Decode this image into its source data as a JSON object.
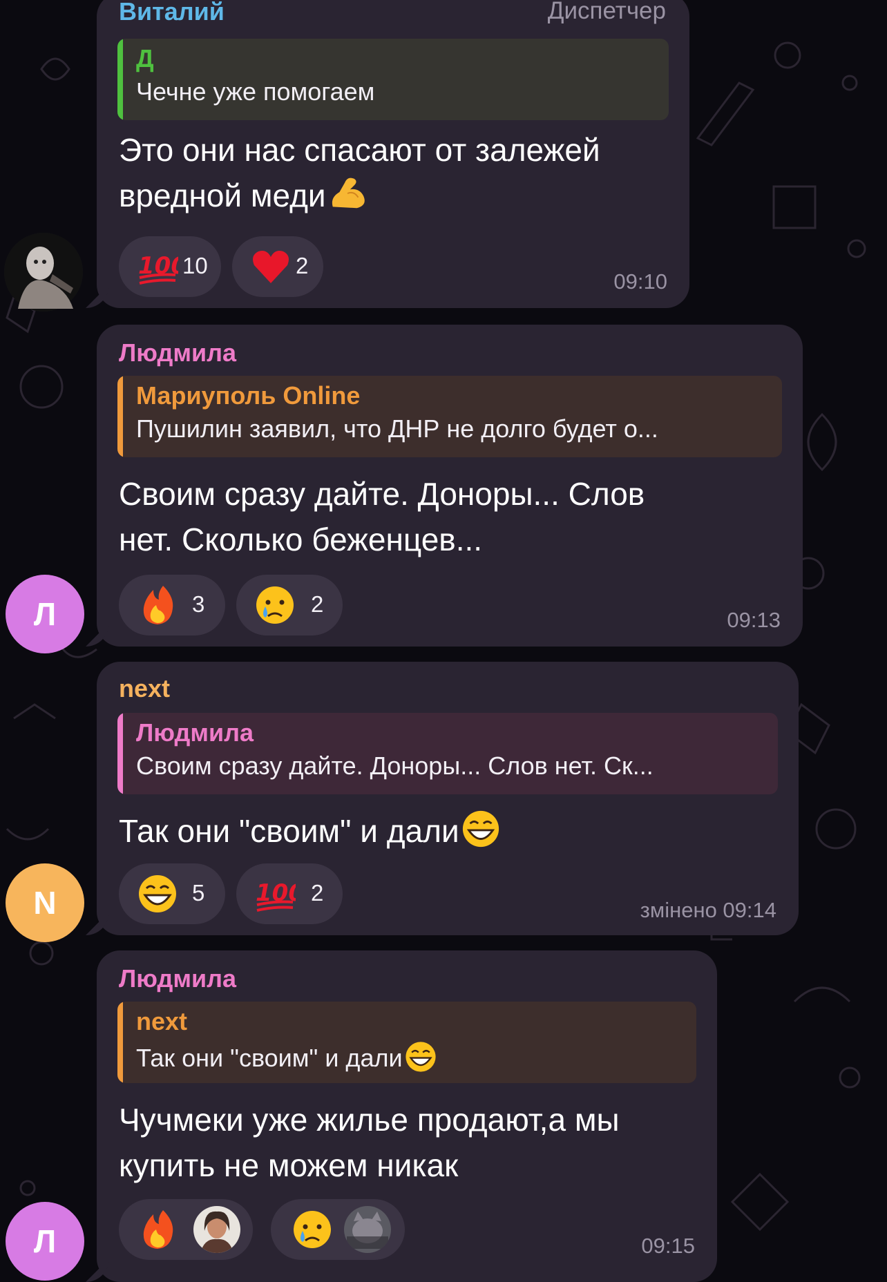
{
  "messages": [
    {
      "sender": "Виталий",
      "role": "Диспетчер",
      "reply_name": "Д",
      "reply_text": "Чечне уже помогаем",
      "text_lines": [
        "Это они нас спасают от залежей",
        "вредной меди"
      ],
      "trailing_emoji": "flexed-biceps-emoji",
      "reactions": [
        {
          "emoji": "hundred-points-emoji",
          "count": "10"
        },
        {
          "emoji": "red-heart-emoji",
          "count": "2"
        }
      ],
      "time": "09:10"
    },
    {
      "sender": "Людмила",
      "avatar_letter": "Л",
      "reply_name": "Мариуполь Online",
      "reply_text": "Пушилин заявил, что ДНР не долго будет о...",
      "text_lines": [
        "Своим сразу дайте. Доноры... Слов",
        "нет. Сколько беженцев..."
      ],
      "reactions": [
        {
          "emoji": "fire-emoji",
          "count": "3"
        },
        {
          "emoji": "crying-face-emoji",
          "count": "2"
        }
      ],
      "time": "09:13"
    },
    {
      "sender": "next",
      "avatar_letter": "N",
      "reply_name": "Людмила",
      "reply_text": "Своим сразу дайте. Доноры... Слов нет. Ск...",
      "text_lines": [
        "Так они \"своим\" и дали"
      ],
      "trailing_emoji": "grinning-face-emoji",
      "reactions": [
        {
          "emoji": "grinning-face-emoji",
          "count": "5"
        },
        {
          "emoji": "hundred-points-emoji",
          "count": "2"
        }
      ],
      "time": "змінено 09:14"
    },
    {
      "sender": "Людмила",
      "avatar_letter": "Л",
      "reply_name": "next",
      "reply_text": "Так они \"своим\" и дали",
      "text_lines": [
        "Чучмеки уже жилье продают,а мы",
        "купить не можем никак"
      ],
      "reactions": [
        {
          "emoji": "fire-emoji",
          "reactor": "user-avatar"
        },
        {
          "emoji": "crying-face-emoji",
          "reactor": "user-avatar"
        }
      ],
      "time": "09:15"
    }
  ],
  "colors": {
    "bubble": "#2a2432",
    "pill": "#3b3444",
    "vitaly": "#5fb8e8",
    "green_reply": "#4fc13f",
    "pink": "#ee7bc8",
    "orange": "#f09a3c",
    "next_name": "#f5b25e",
    "avatar_pink": "#d77be4",
    "avatar_orange": "#f7b55c"
  }
}
